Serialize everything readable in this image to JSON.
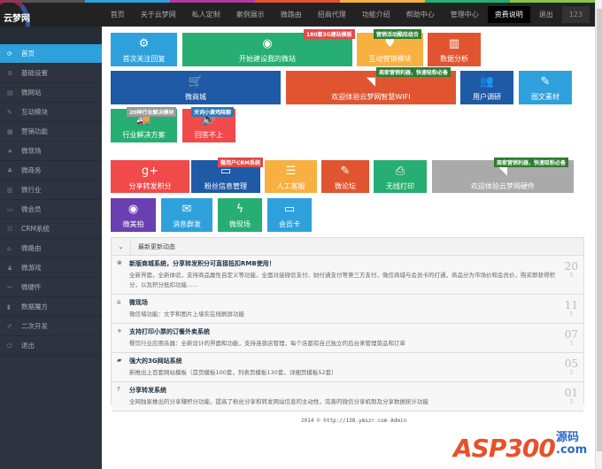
{
  "app": {
    "logo": "云梦网",
    "strip_colors": [
      "#555",
      "#2ea1dc",
      "#b03aa0",
      "#e05530",
      "#f8b040",
      "#27ae72",
      "#8bc34a"
    ]
  },
  "nav": {
    "items": [
      "首页",
      "关于云梦网",
      "私人定制",
      "案例展示",
      "微路由",
      "招商代理",
      "功能介绍",
      "帮助中心",
      "管理中心",
      "资费说明",
      "退出"
    ],
    "active": "资费说明",
    "counter": "123"
  },
  "sidebar": {
    "items": [
      {
        "icon": "⟳",
        "label": "首页"
      },
      {
        "icon": "⚙",
        "label": "基础设置"
      },
      {
        "icon": "▤",
        "label": "微网站"
      },
      {
        "icon": "✎",
        "label": "互动模块"
      },
      {
        "icon": "▦",
        "label": "营销功能"
      },
      {
        "icon": "★",
        "label": "微现场"
      },
      {
        "icon": "♣",
        "label": "微商务"
      },
      {
        "icon": "▥",
        "label": "微行业"
      },
      {
        "icon": "▭",
        "label": "微会员"
      },
      {
        "icon": "☷",
        "label": "CRM系统"
      },
      {
        "icon": "⌂",
        "label": "微路由"
      },
      {
        "icon": "♟",
        "label": "微游戏"
      },
      {
        "icon": "✂",
        "label": "微硬件"
      },
      {
        "icon": "▮",
        "label": "数据魔方"
      },
      {
        "icon": "✐",
        "label": "二次开发"
      },
      {
        "icon": "⏻",
        "label": "退出"
      }
    ]
  },
  "tiles": [
    {
      "label": "首次关注回复",
      "icon": "⚙",
      "color": "#2ea1dc"
    },
    {
      "label": "开始建设我的微站",
      "icon": "◉",
      "color": "#27ae72"
    },
    {
      "label": "互动营销模块",
      "icon": "♥",
      "color": "#f8b040"
    },
    {
      "label": "数据分析",
      "icon": "▥",
      "color": "#e05530"
    },
    {
      "label": "微商城",
      "icon": "🛒",
      "color": "#1f5aa6"
    },
    {
      "label": "欢迎体验云梦网智慧WIFI",
      "icon": "◥",
      "color": "#e05530"
    },
    {
      "label": "用户调研",
      "icon": "👥",
      "color": "#1f5aa6"
    },
    {
      "label": "图文素材",
      "icon": "✎",
      "color": "#2ea1dc"
    },
    {
      "label": "行业解决方案",
      "icon": "🚚",
      "color": "#27ae72"
    },
    {
      "label": "回答不上",
      "icon": "🔊",
      "color": "#f04a4a"
    },
    {
      "label": "分享转发积分",
      "icon": "g+",
      "color": "#f04a4a"
    },
    {
      "label": "粉丝信息管理",
      "icon": "▭",
      "color": "#1f5aa6"
    },
    {
      "label": "人工客服",
      "icon": "☰",
      "color": "#f8b040"
    },
    {
      "label": "微论坛",
      "icon": "✎",
      "color": "#e05530"
    },
    {
      "label": "无线打印",
      "icon": "⎙",
      "color": "#27ae72"
    },
    {
      "label": "欢迎体验云梦网硬件",
      "icon": "◥",
      "color": "#aaaaaa"
    },
    {
      "label": "微美拍",
      "icon": "◉",
      "color": "#6a3fb0"
    },
    {
      "label": "消息群发",
      "icon": "✉",
      "color": "#2ea1dc"
    },
    {
      "label": "微现场",
      "icon": "ϟ",
      "color": "#27ae72"
    },
    {
      "label": "会员卡",
      "icon": "▭",
      "color": "#2ea1dc"
    }
  ],
  "badges": [
    {
      "text": "180套3G建站模板",
      "color": "#e04a4a"
    },
    {
      "text": "营销活动酷炫组合",
      "color": "#2e7d32"
    },
    {
      "text": "商家营销利器，快速吸粉必备",
      "color": "#2e7d32"
    },
    {
      "text": "20种行业解决模块",
      "color": "#999999"
    },
    {
      "text": "关词小黄鸡陪聊",
      "color": "#2a7ab8"
    },
    {
      "text": "微用户CRM系统",
      "color": "#e04a4a"
    },
    {
      "text": "商家营销利器，快速吸粉必备",
      "color": "#2e7d32"
    }
  ],
  "news": {
    "title": "最新更新动态",
    "items": [
      {
        "icon": "⊗",
        "title": "新版商城系统，分享转发积分可直接抵扣RMB使用！",
        "desc": "全新界面，全新体验，支持商品属性自定义等功能，全面对接微信支付、财付通支付等第三方支付，微信商城与会员卡的打通，商品分为市场价和会员价，购买即获得积分，以及积分抵扣功能……",
        "day": "20",
        "month": "5"
      },
      {
        "icon": "⌂",
        "title": "微现场",
        "desc": "微信墙功能：文字和图片上墙实在线刷屏功能",
        "day": "11",
        "month": "5"
      },
      {
        "icon": "+",
        "title": "支持打印小票的订餐外卖系统",
        "desc": "餐饮行业应用杀器：全新设计的界面和功能，支持连锁店管理，每个店都有自己独立的后台来管理菜品和订单",
        "day": "07",
        "month": "5"
      },
      {
        "icon": "▰",
        "title": "强大的3G网站系统",
        "desc": "新推出上百套网站模板（首页模板100套，列表页模板130套，详细页模板52套）",
        "day": "05",
        "month": "5"
      },
      {
        "icon": "?",
        "title": "分享转发系统",
        "desc": "全网独家推出的分享赚积分功能，提高了粉丝分享和转发网站信息的主动性，完善的微信分享机制及分享数据统计功能",
        "day": "01",
        "month": "5"
      }
    ]
  },
  "footer": "2014 © http://138.ymszr.com Admin",
  "watermark": {
    "text": "ASP300",
    "sub": "源码 .com"
  }
}
